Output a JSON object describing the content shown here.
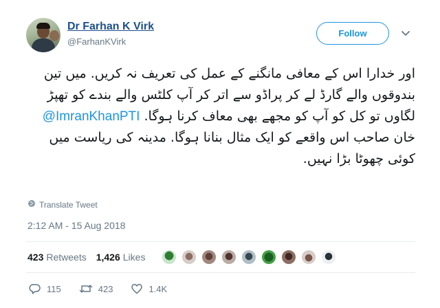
{
  "author": {
    "name": "Dr Farhan K Virk",
    "handle": "@FarhanKVirk"
  },
  "follow_label": "Follow",
  "tweet": {
    "text_part1": "اور خدارا اس کے معافی مانگنے کے عمل کی تعریف نہ کریں. میں تین بندوقوں والے گارڈ لے کر پراڈو سے اتر کر آپ کلٹس والے بندے کو تھپڑ لگاوں تو کل کو آپ کو مجھے بھی معاف کرنا ہوگا.",
    "mention": "@ImranKhanPTI",
    "text_part2": "خان صاحب اس واقعے کو ایک مثال بنانا ہوگا. مدینہ کی ریاست میں کوئی چھوٹا بڑا نہیں."
  },
  "translate_label": "Translate Tweet",
  "timestamp": "2:12 AM - 15 Aug 2018",
  "stats": {
    "retweets_count": "423",
    "retweets_label": "Retweets",
    "likes_count": "1,426",
    "likes_label": "Likes"
  },
  "actions": {
    "replies": "115",
    "retweets": "423",
    "likes": "1.4K"
  },
  "colors": {
    "link": "#1b95e0",
    "name": "#1b4f8c",
    "muted": "#657786",
    "retweet": "#17bf63"
  }
}
